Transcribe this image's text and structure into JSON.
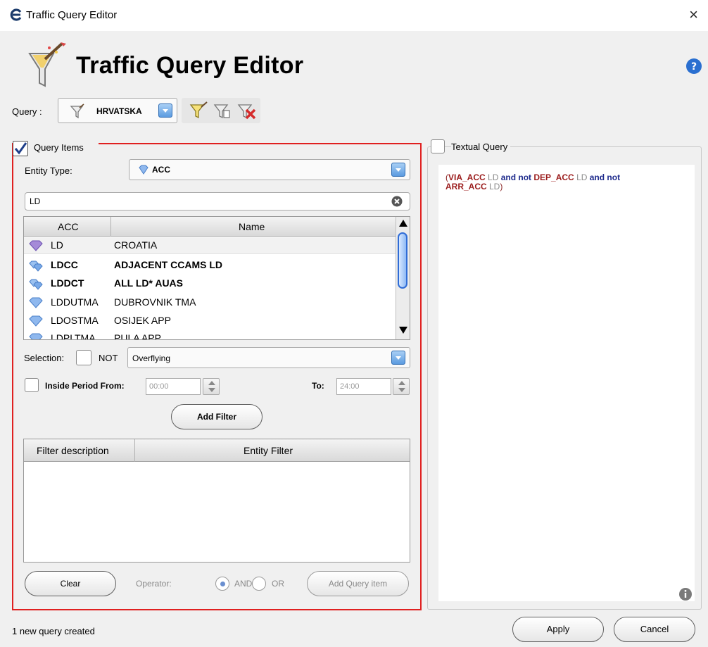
{
  "window": {
    "title": "Traffic Query Editor",
    "close_glyph": "×"
  },
  "header": {
    "title": "Traffic Query Editor",
    "icon": "funnel-wand-icon",
    "help_icon": "help-icon"
  },
  "query_bar": {
    "label": "Query :",
    "selected": "HRVATSKA",
    "tools": [
      "new-query-icon",
      "edit-query-icon",
      "delete-query-icon"
    ]
  },
  "query_items": {
    "label": "Query Items",
    "checked": true,
    "entity_type_label": "Entity Type:",
    "entity_type_value": "ACC",
    "search_value": "LD",
    "table": {
      "columns": [
        "ACC",
        "Name"
      ],
      "rows": [
        {
          "acc": "LD",
          "name": "CROATIA",
          "bold": false,
          "icon": "purple-gem-icon"
        },
        {
          "acc": "LDCC",
          "name": "ADJACENT CCAMS LD",
          "bold": true,
          "icon": "multi-gem-icon"
        },
        {
          "acc": "LDDCT",
          "name": "ALL LD* AUAS",
          "bold": true,
          "icon": "multi-gem-icon"
        },
        {
          "acc": "LDDUTMA",
          "name": "DUBROVNIK TMA",
          "bold": false,
          "icon": "blue-gem-icon"
        },
        {
          "acc": "LDOSTMA",
          "name": "OSIJEK APP",
          "bold": false,
          "icon": "blue-gem-icon"
        },
        {
          "acc": "LDPLTMA",
          "name": "PULA APP",
          "bold": false,
          "icon": "blue-gem-icon"
        }
      ]
    },
    "selection_label": "Selection:",
    "not_label": "NOT",
    "selection_value": "Overflying",
    "inside_period_label": "Inside Period From:",
    "from_value": "00:00",
    "to_label": "To:",
    "to_value": "24:00",
    "add_filter_label": "Add Filter",
    "filter_table": {
      "columns": [
        "Filter description",
        "Entity Filter"
      ]
    },
    "clear_label": "Clear",
    "operator_label": "Operator:",
    "and_label": "AND",
    "or_label": "OR",
    "add_query_item_label": "Add Query item"
  },
  "textual_query": {
    "label": "Textual Query",
    "checked": false,
    "tokens": [
      {
        "text": "(",
        "style": "paren"
      },
      {
        "text": "VIA_ACC",
        "style": "kw-red"
      },
      {
        "text": " LD ",
        "style": "val-grey"
      },
      {
        "text": "and not ",
        "style": "kw-blue"
      },
      {
        "text": "DEP_ACC",
        "style": "kw-red"
      },
      {
        "text": " LD ",
        "style": "val-grey"
      },
      {
        "text": "and not ",
        "style": "kw-blue"
      },
      {
        "text": "ARR_ACC",
        "style": "kw-red"
      },
      {
        "text": " LD",
        "style": "val-grey"
      },
      {
        "text": ")",
        "style": "paren"
      }
    ]
  },
  "footer": {
    "status": "1 new query created",
    "apply_label": "Apply",
    "cancel_label": "Cancel"
  },
  "colors": {
    "highlight_border": "#e02020",
    "accent_blue": "#2f6cd6"
  }
}
